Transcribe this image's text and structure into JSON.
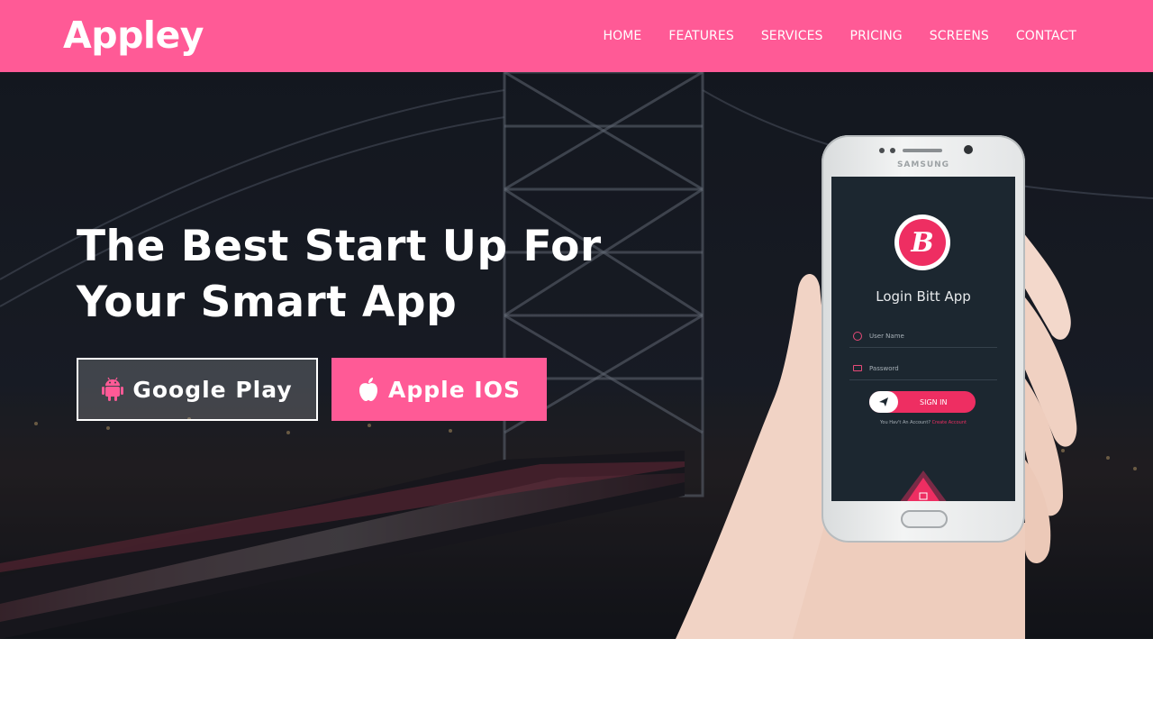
{
  "brand": {
    "name": "Appley"
  },
  "nav": {
    "items": [
      {
        "label": "HOME"
      },
      {
        "label": "FEATURES"
      },
      {
        "label": "SERVICES"
      },
      {
        "label": "PRICING"
      },
      {
        "label": "SCREENS"
      },
      {
        "label": "CONTACT"
      }
    ]
  },
  "hero": {
    "title_line1": "The Best Start Up For",
    "title_line2": "Your Smart App",
    "buttons": {
      "google": {
        "label": "Google Play",
        "icon": "android-icon"
      },
      "apple": {
        "label": "Apple IOS",
        "icon": "apple-icon"
      }
    }
  },
  "phone": {
    "maker": "SAMSUNG",
    "app_logo_letter": "B",
    "app_title": "Login Bitt App",
    "username_placeholder": "User Name",
    "password_placeholder": "Password",
    "signin_label": "SIGN IN",
    "create_prompt": "You Hav't An Account?",
    "create_link": "Create Account"
  },
  "colors": {
    "accent": "#ff5a96",
    "app_accent": "#ee2e62",
    "screen_bg": "#1c2730"
  }
}
